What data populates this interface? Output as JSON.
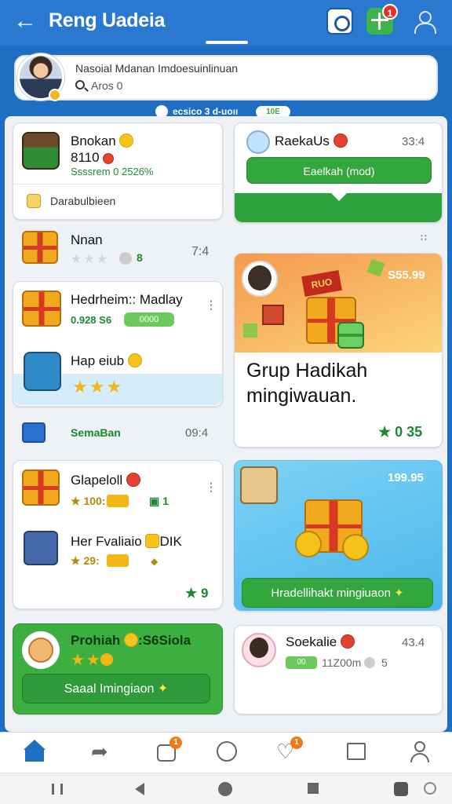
{
  "header": {
    "title": "Reng Uadeia",
    "notification_count": "1"
  },
  "profile": {
    "name": "Nasoial Mdanan Imdoesuinlinuan",
    "search_placeholder": "Aros 0"
  },
  "status": {
    "text": "ecsico 3 d-uoıı",
    "pill": "10E"
  },
  "left": {
    "card1": {
      "title": "Bnokan",
      "line2": "8110",
      "line3": "Ssssrem 0  2526%",
      "footer": "Darabulbieen"
    },
    "row_single": {
      "title": "Nnan",
      "time": "7:4",
      "count": "8"
    },
    "card2": {
      "item1": {
        "title": "Hedrheim:: Madlay",
        "value": "0.928 S6",
        "pill": "0000"
      },
      "item2": {
        "title": "Hap eiub"
      }
    },
    "row_semaban": {
      "title": "SemaBan",
      "time": "09:4"
    },
    "card3": {
      "item1": {
        "title": "Glapeloll",
        "stars": "100:",
        "pill": "1"
      },
      "item2": {
        "title": "Her Fvaliaio",
        "suffix": "DIK",
        "stars": "29:"
      },
      "count": "9"
    },
    "promo": {
      "title": "Prohiah",
      "suffix": ":S6Siola",
      "button": "Saaal Imingiaon"
    }
  },
  "right": {
    "card1": {
      "title": "RaekaUs",
      "time": "33:4",
      "button": "Eaelkah (mod)"
    },
    "promo1": {
      "price": "S55.99",
      "ribbon": "RUO",
      "title_line1": "Grup Hadikah",
      "title_line2": "mingiwauan.",
      "count": "0 35"
    },
    "promo2": {
      "price": "199.95",
      "button": "Hradellihakt mingiuaon"
    },
    "card2": {
      "title": "Soekalie",
      "value": "11Z00m",
      "count": "5",
      "pill": "00",
      "time": "43.4"
    }
  },
  "colors": {
    "brand_blue": "#2a78cf",
    "accent_green": "#34a63e",
    "star_gold": "#f2b617"
  },
  "nav": {
    "items": [
      "home-icon",
      "share-icon",
      "edit-icon",
      "clock-icon",
      "heart-icon",
      "mail-icon",
      "profile-icon"
    ],
    "badge_edit": "1",
    "badge_heart": "1"
  }
}
